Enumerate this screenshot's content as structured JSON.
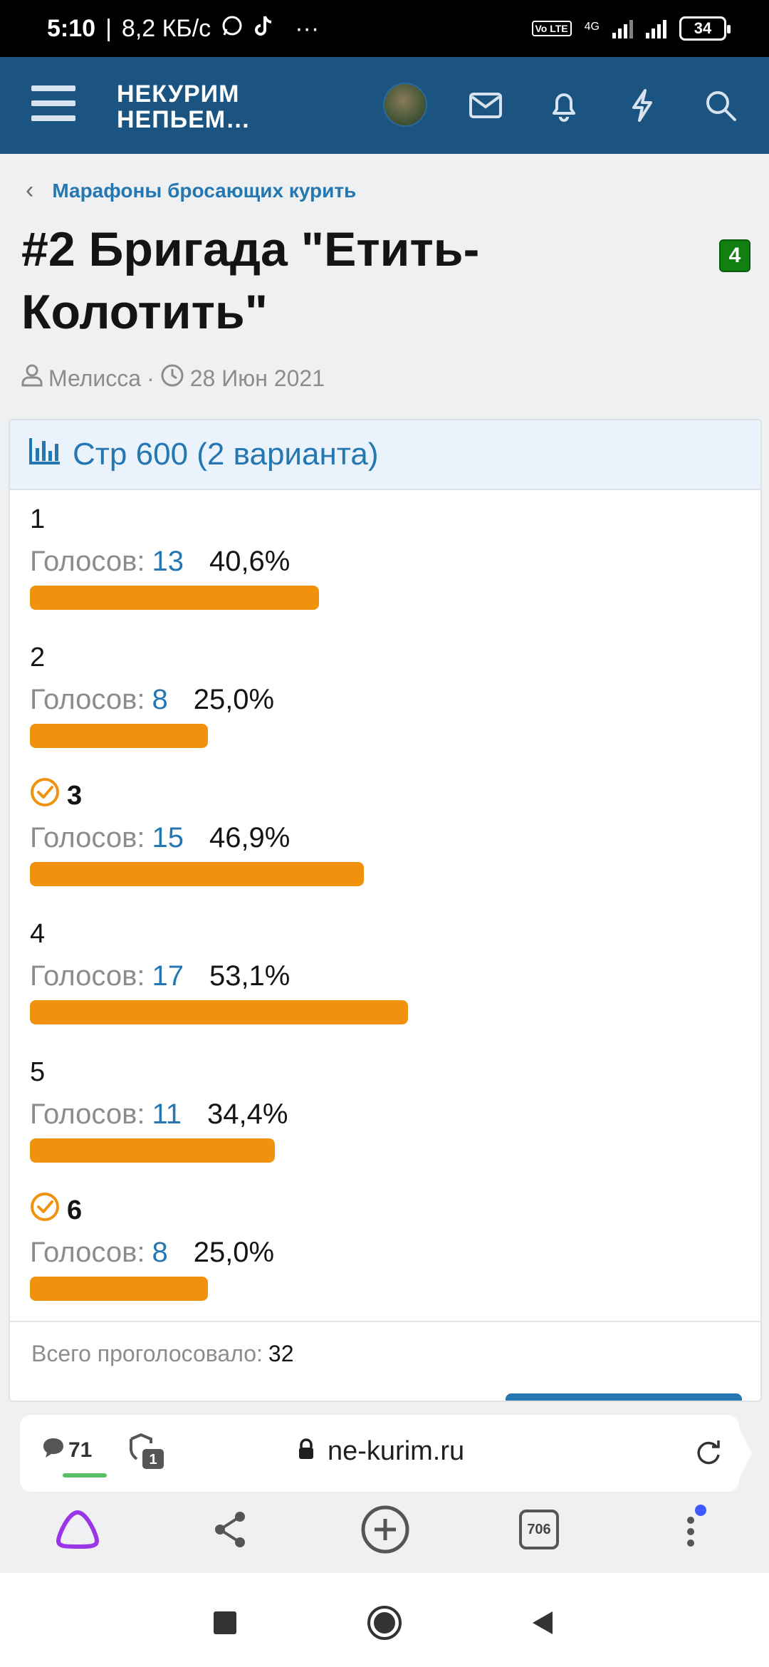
{
  "status_bar": {
    "time": "5:10",
    "speed": "8,2 КБ/с",
    "network": "4G",
    "volte": "Vo LTE",
    "battery": "34"
  },
  "header": {
    "logo_line1": "НЕКУРИМ",
    "logo_line2": "НЕПЬЕМ…"
  },
  "breadcrumb": {
    "label": "Марафоны бросающих курить"
  },
  "thread": {
    "title": "#2 Бригада \"Етить-Колотить\"",
    "badge": "4",
    "author": "Мелисса",
    "separator": "·",
    "date": "28 Июн 2021"
  },
  "poll": {
    "title": "Стр 600 (2 варианта)",
    "votes_label": "Голосов:",
    "options": [
      {
        "label": "1",
        "votes": "13",
        "percent": "40,6%",
        "fraction": 0.406,
        "voted": false
      },
      {
        "label": "2",
        "votes": "8",
        "percent": "25,0%",
        "fraction": 0.25,
        "voted": false
      },
      {
        "label": "3",
        "votes": "15",
        "percent": "46,9%",
        "fraction": 0.469,
        "voted": true
      },
      {
        "label": "4",
        "votes": "17",
        "percent": "53,1%",
        "fraction": 0.531,
        "voted": false
      },
      {
        "label": "5",
        "votes": "11",
        "percent": "34,4%",
        "fraction": 0.344,
        "voted": false
      },
      {
        "label": "6",
        "votes": "8",
        "percent": "25,0%",
        "fraction": 0.25,
        "voted": true
      }
    ],
    "total_label": "Всего проголосовало:",
    "total_value": "32"
  },
  "browser": {
    "comments_count": "71",
    "tabs_badge": "1",
    "url": "ne-kurim.ru",
    "tabs_count": "706"
  },
  "colors": {
    "header_bg": "#1b5480",
    "link": "#2577b1",
    "bar": "#f0920e",
    "badge": "#127f12"
  }
}
